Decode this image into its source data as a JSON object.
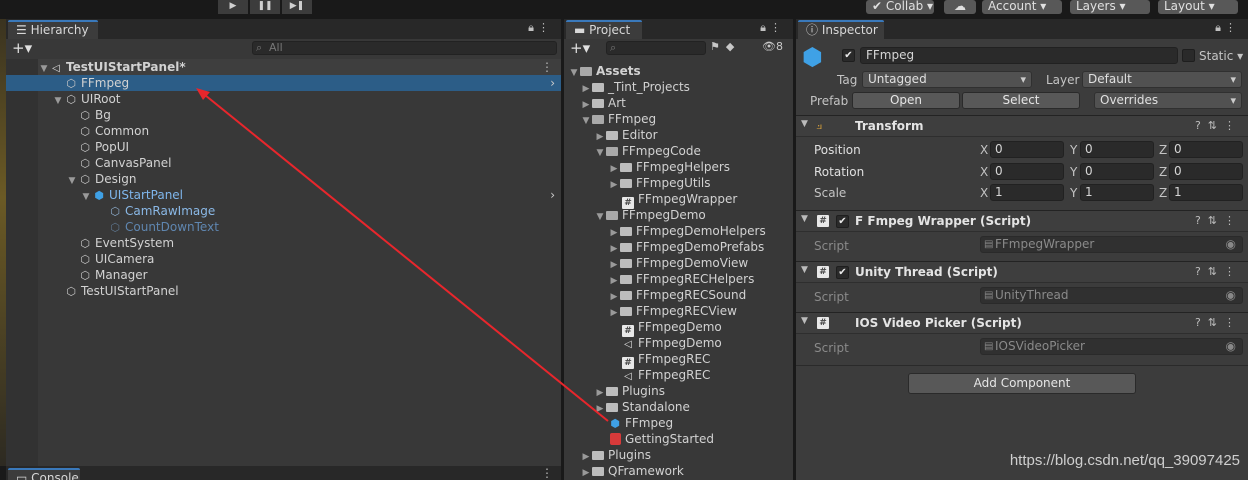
{
  "toolbar": {
    "play": "▶",
    "pause": "❚❚",
    "step": "▶❚",
    "collab": "Collab",
    "cloud": "☁",
    "account": "Account",
    "layers": "Layers",
    "layout": "Layout"
  },
  "hierarchy": {
    "tab": "Hierarchy",
    "search_placeholder": "All",
    "rows": [
      {
        "label": "TestUIStartPanel*"
      },
      {
        "label": "FFmpeg"
      },
      {
        "label": "UIRoot"
      },
      {
        "label": "Bg"
      },
      {
        "label": "Common"
      },
      {
        "label": "PopUI"
      },
      {
        "label": "CanvasPanel"
      },
      {
        "label": "Design"
      },
      {
        "label": "UIStartPanel"
      },
      {
        "label": "CamRawImage"
      },
      {
        "label": "CountDownText"
      },
      {
        "label": "EventSystem"
      },
      {
        "label": "UICamera"
      },
      {
        "label": "Manager"
      },
      {
        "label": "TestUIStartPanel"
      }
    ]
  },
  "console": {
    "tab": "Console"
  },
  "project": {
    "tab": "Project",
    "badge": "8",
    "rows": [
      {
        "label": "Assets"
      },
      {
        "label": "_Tint_Projects"
      },
      {
        "label": "Art"
      },
      {
        "label": "FFmpeg"
      },
      {
        "label": "Editor"
      },
      {
        "label": "FFmpegCode"
      },
      {
        "label": "FFmpegHelpers"
      },
      {
        "label": "FFmpegUtils"
      },
      {
        "label": "FFmpegWrapper"
      },
      {
        "label": "FFmpegDemo"
      },
      {
        "label": "FFmpegDemoHelpers"
      },
      {
        "label": "FFmpegDemoPrefabs"
      },
      {
        "label": "FFmpegDemoView"
      },
      {
        "label": "FFmpegRECHelpers"
      },
      {
        "label": "FFmpegRECSound"
      },
      {
        "label": "FFmpegRECView"
      },
      {
        "label": "FFmpegDemo"
      },
      {
        "label": "FFmpegDemo"
      },
      {
        "label": "FFmpegREC"
      },
      {
        "label": "FFmpegREC"
      },
      {
        "label": "Plugins"
      },
      {
        "label": "Standalone"
      },
      {
        "label": "FFmpeg"
      },
      {
        "label": "GettingStarted"
      },
      {
        "label": "Plugins"
      },
      {
        "label": "QFramework"
      }
    ]
  },
  "inspector": {
    "tab": "Inspector",
    "object_name": "FFmpeg",
    "static_label": "Static",
    "tag_label": "Tag",
    "tag_value": "Untagged",
    "layer_label": "Layer",
    "layer_value": "Default",
    "prefab_label": "Prefab",
    "open": "Open",
    "select": "Select",
    "overrides": "Overrides",
    "transform": {
      "title": "Transform",
      "position": "Position",
      "rotation": "Rotation",
      "scale": "Scale",
      "pos": [
        "0",
        "0",
        "0"
      ],
      "rot": [
        "0",
        "0",
        "0"
      ],
      "scl": [
        "1",
        "1",
        "1"
      ],
      "x": "X",
      "y": "Y",
      "z": "Z"
    },
    "components": [
      {
        "title": "F Fmpeg Wrapper (Script)",
        "script_label": "Script",
        "script_value": "FFmpegWrapper"
      },
      {
        "title": "Unity Thread (Script)",
        "script_label": "Script",
        "script_value": "UnityThread"
      },
      {
        "title": "IOS Video Picker (Script)",
        "script_label": "Script",
        "script_value": "IOSVideoPicker"
      }
    ],
    "add_component": "Add Component"
  },
  "watermark": "https://blog.csdn.net/qq_39097425",
  "colors": {
    "selection": "#2c5d87",
    "accent_blue": "#3fa1e6",
    "arrow_red": "#e8262c"
  }
}
